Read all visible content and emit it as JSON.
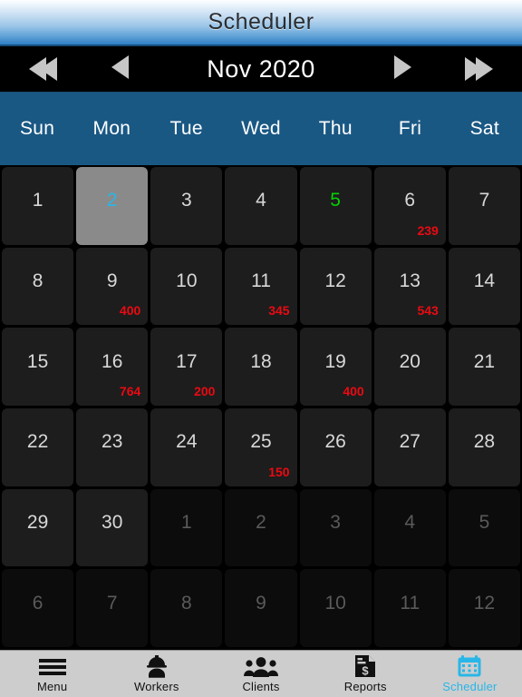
{
  "header": {
    "title": "Scheduler"
  },
  "monthnav": {
    "label": "Nov 2020",
    "prev_year_icon": "double-left-arrow-icon",
    "prev_month_icon": "left-arrow-icon",
    "next_month_icon": "right-arrow-icon",
    "next_year_icon": "double-right-arrow-icon"
  },
  "weekdays": [
    "Sun",
    "Mon",
    "Tue",
    "Wed",
    "Thu",
    "Fri",
    "Sat"
  ],
  "colors": {
    "accent": "#29b6e8",
    "selected_bg": "#8a8a8a",
    "selected_text": "#29b6e8",
    "today_text": "#05d105",
    "amount_text": "#ea0a12",
    "weekday_header_bg": "#1a5884",
    "cell_bg": "#1d1d1d",
    "cell_out_bg": "#0c0c0c",
    "tabbar_bg": "#cdcdcd"
  },
  "calendar": {
    "rows": [
      [
        {
          "day": "1",
          "amount": "",
          "state": "in"
        },
        {
          "day": "2",
          "amount": "",
          "state": "selected"
        },
        {
          "day": "3",
          "amount": "",
          "state": "in"
        },
        {
          "day": "4",
          "amount": "",
          "state": "in"
        },
        {
          "day": "5",
          "amount": "",
          "state": "today"
        },
        {
          "day": "6",
          "amount": "239",
          "state": "in"
        },
        {
          "day": "7",
          "amount": "",
          "state": "in"
        }
      ],
      [
        {
          "day": "8",
          "amount": "",
          "state": "in"
        },
        {
          "day": "9",
          "amount": "400",
          "state": "in"
        },
        {
          "day": "10",
          "amount": "",
          "state": "in"
        },
        {
          "day": "11",
          "amount": "345",
          "state": "in"
        },
        {
          "day": "12",
          "amount": "",
          "state": "in"
        },
        {
          "day": "13",
          "amount": "543",
          "state": "in"
        },
        {
          "day": "14",
          "amount": "",
          "state": "in"
        }
      ],
      [
        {
          "day": "15",
          "amount": "",
          "state": "in"
        },
        {
          "day": "16",
          "amount": "764",
          "state": "in"
        },
        {
          "day": "17",
          "amount": "200",
          "state": "in"
        },
        {
          "day": "18",
          "amount": "",
          "state": "in"
        },
        {
          "day": "19",
          "amount": "400",
          "state": "in"
        },
        {
          "day": "20",
          "amount": "",
          "state": "in"
        },
        {
          "day": "21",
          "amount": "",
          "state": "in"
        }
      ],
      [
        {
          "day": "22",
          "amount": "",
          "state": "in"
        },
        {
          "day": "23",
          "amount": "",
          "state": "in"
        },
        {
          "day": "24",
          "amount": "",
          "state": "in"
        },
        {
          "day": "25",
          "amount": "150",
          "state": "in"
        },
        {
          "day": "26",
          "amount": "",
          "state": "in"
        },
        {
          "day": "27",
          "amount": "",
          "state": "in"
        },
        {
          "day": "28",
          "amount": "",
          "state": "in"
        }
      ],
      [
        {
          "day": "29",
          "amount": "",
          "state": "in"
        },
        {
          "day": "30",
          "amount": "",
          "state": "in"
        },
        {
          "day": "1",
          "amount": "",
          "state": "out"
        },
        {
          "day": "2",
          "amount": "",
          "state": "out"
        },
        {
          "day": "3",
          "amount": "",
          "state": "out"
        },
        {
          "day": "4",
          "amount": "",
          "state": "out"
        },
        {
          "day": "5",
          "amount": "",
          "state": "out"
        }
      ],
      [
        {
          "day": "6",
          "amount": "",
          "state": "out"
        },
        {
          "day": "7",
          "amount": "",
          "state": "out"
        },
        {
          "day": "8",
          "amount": "",
          "state": "out"
        },
        {
          "day": "9",
          "amount": "",
          "state": "out"
        },
        {
          "day": "10",
          "amount": "",
          "state": "out"
        },
        {
          "day": "11",
          "amount": "",
          "state": "out"
        },
        {
          "day": "12",
          "amount": "",
          "state": "out"
        }
      ]
    ]
  },
  "tabbar": {
    "items": [
      {
        "label": "Menu",
        "icon": "hamburger-menu-icon",
        "active": false
      },
      {
        "label": "Workers",
        "icon": "worker-hardhat-icon",
        "active": false
      },
      {
        "label": "Clients",
        "icon": "people-group-icon",
        "active": false
      },
      {
        "label": "Reports",
        "icon": "document-dollar-icon",
        "active": false
      },
      {
        "label": "Scheduler",
        "icon": "calendar-icon",
        "active": true
      }
    ]
  }
}
